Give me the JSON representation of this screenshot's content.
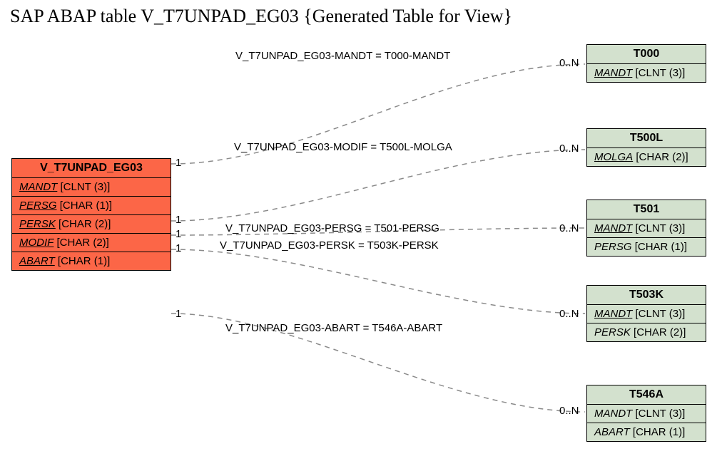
{
  "title": "SAP ABAP table V_T7UNPAD_EG03 {Generated Table for View}",
  "main": {
    "name": "V_T7UNPAD_EG03",
    "fields": [
      {
        "name": "MANDT",
        "type": "[CLNT (3)]",
        "key": true
      },
      {
        "name": "PERSG",
        "type": "[CHAR (1)]",
        "key": true
      },
      {
        "name": "PERSK",
        "type": "[CHAR (2)]",
        "key": true
      },
      {
        "name": "MODIF",
        "type": "[CHAR (2)]",
        "key": true
      },
      {
        "name": "ABART",
        "type": "[CHAR (1)]",
        "key": true
      }
    ]
  },
  "targets": [
    {
      "name": "T000",
      "fields": [
        {
          "name": "MANDT",
          "type": "[CLNT (3)]",
          "key": true
        }
      ]
    },
    {
      "name": "T500L",
      "fields": [
        {
          "name": "MOLGA",
          "type": "[CHAR (2)]",
          "key": true
        }
      ]
    },
    {
      "name": "T501",
      "fields": [
        {
          "name": "MANDT",
          "type": "[CLNT (3)]",
          "key": true
        },
        {
          "name": "PERSG",
          "type": "[CHAR (1)]",
          "key": false
        }
      ]
    },
    {
      "name": "T503K",
      "fields": [
        {
          "name": "MANDT",
          "type": "[CLNT (3)]",
          "key": true
        },
        {
          "name": "PERSK",
          "type": "[CHAR (2)]",
          "key": false
        }
      ]
    },
    {
      "name": "T546A",
      "fields": [
        {
          "name": "MANDT",
          "type": "[CLNT (3)]",
          "key": false
        },
        {
          "name": "ABART",
          "type": "[CHAR (1)]",
          "key": false
        }
      ]
    }
  ],
  "edges": [
    {
      "label": "V_T7UNPAD_EG03-MANDT = T000-MANDT",
      "left": "1",
      "right": "0..N"
    },
    {
      "label": "V_T7UNPAD_EG03-MODIF = T500L-MOLGA",
      "left": "1",
      "right": "0..N"
    },
    {
      "label": "V_T7UNPAD_EG03-PERSG = T501-PERSG",
      "left": "1",
      "right": "0..N"
    },
    {
      "label": "V_T7UNPAD_EG03-PERSK = T503K-PERSK",
      "left": "1",
      "right": "0..N"
    },
    {
      "label": "V_T7UNPAD_EG03-ABART = T546A-ABART",
      "left": "1",
      "right": "0..N"
    }
  ]
}
